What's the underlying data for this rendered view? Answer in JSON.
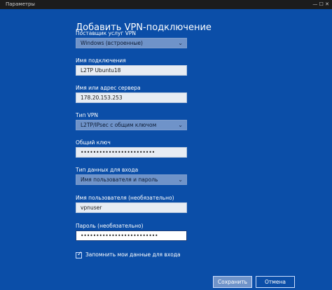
{
  "window": {
    "title": "Параметры",
    "controls": "—  ☐  ✕"
  },
  "dialog": {
    "heading": "Добавить VPN-подключение"
  },
  "provider": {
    "label": "Поставщик услуг VPN",
    "value": "Windows (встроенные)"
  },
  "connection_name": {
    "label": "Имя подключения",
    "value": "L2TP Ubuntu18"
  },
  "server": {
    "label": "Имя или адрес сервера",
    "value": "178.20.153.253"
  },
  "vpn_type": {
    "label": "Тип VPN",
    "value": "L2TP/IPsec с общим ключом"
  },
  "shared_key": {
    "label": "Общий ключ",
    "value": "••••••••••••••••••••••••"
  },
  "signin_type": {
    "label": "Тип данных для входа",
    "value": "Имя пользователя и пароль"
  },
  "username": {
    "label": "Имя пользователя (необязательно)",
    "value": "vpnuser"
  },
  "password": {
    "label": "Пароль (необязательно)",
    "value": "•••••••••••••••••••••••••"
  },
  "remember": {
    "label": "Запомнить мои данные для входа",
    "checked": true
  },
  "buttons": {
    "save": "Сохранить",
    "cancel": "Отмена"
  }
}
